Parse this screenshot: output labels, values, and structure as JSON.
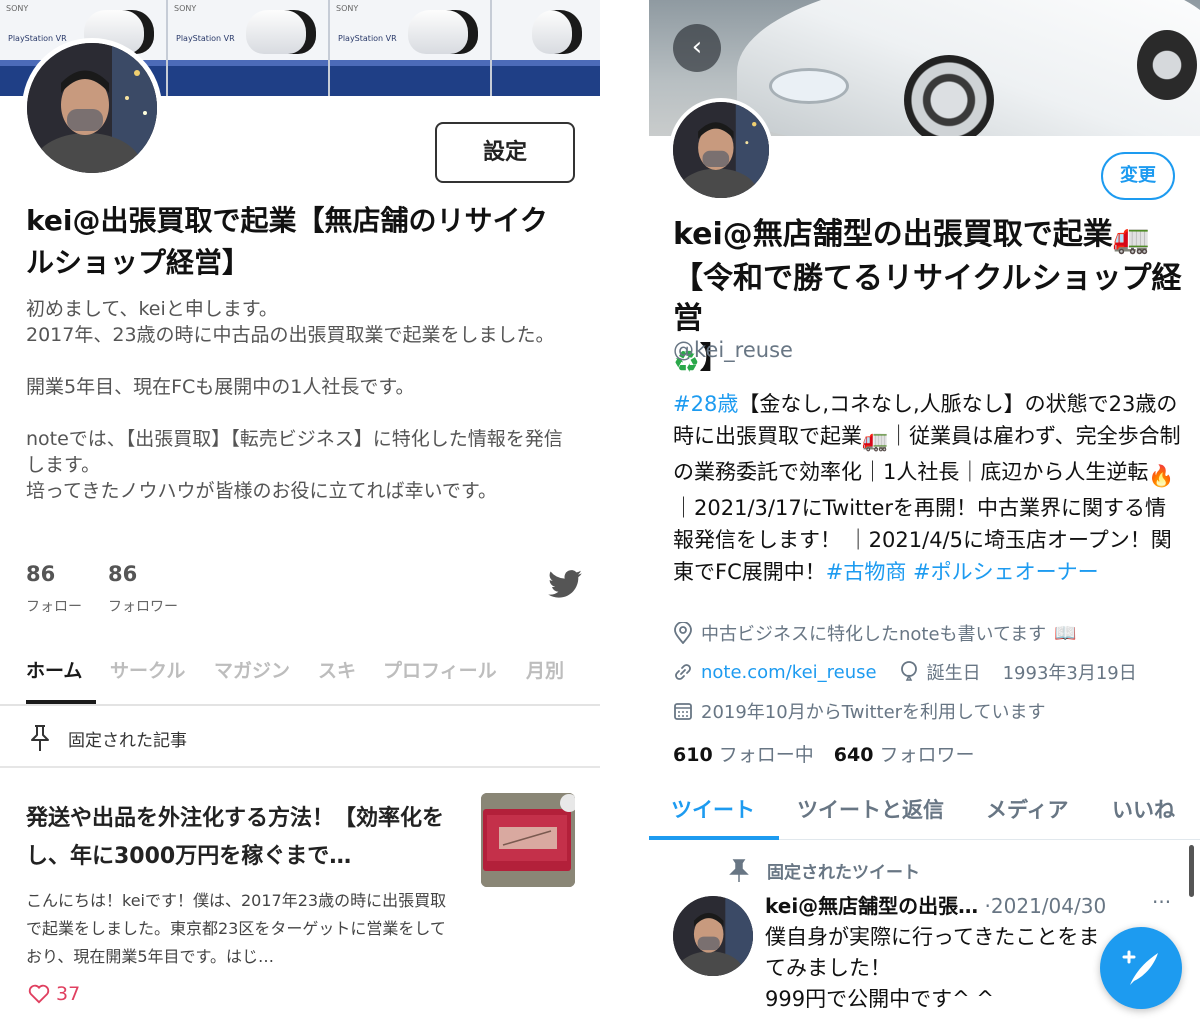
{
  "note_profile": {
    "settings_label": "設定",
    "name": "kei@出張買取で起業【無店舗のリサイクルショップ経営】",
    "bio": [
      "初めまして、keiと申します。\n2017年、23歳の時に中古品の出張買取業で起業をしました。",
      "開業5年目、現在FCも展開中の1人社長です。",
      "noteでは、【出張買取】【転売ビジネス】に特化した情報を発信します。\n培ってきたノウハウが皆様のお役に立てれば幸いです。"
    ],
    "banner": {
      "brand": "SONY",
      "product": "PlayStation VR"
    },
    "stats": [
      {
        "count": "86",
        "label": "フォロー"
      },
      {
        "count": "86",
        "label": "フォロワー"
      }
    ],
    "tabs": [
      "ホーム",
      "サークル",
      "マガジン",
      "スキ",
      "プロフィール",
      "月別"
    ],
    "active_tab": "ホーム",
    "pinned_label": "固定された記事",
    "article": {
      "title": "発送や出品を外注化する方法！【効率化をし、年に3000万円を稼ぐまで…",
      "excerpt": "こんにちは！keiです！僕は、2017年23歳の時に出張買取で起業をしました。東京都23区をターゲットに営業をしており、現在開業5年目です。はじ…",
      "likes": "37"
    }
  },
  "twitter_profile": {
    "edit_label": "変更",
    "name_line1": "kei@無店舗型の出張買取で起業",
    "name_line2": "【令和で勝てるリサイクルショップ経営",
    "name_line2_end": "】",
    "handle": "@kei_reuse",
    "bio": {
      "tag1": "#28歳",
      "text1": "【金なし,コネなし,人脈なし】の状態で23歳の時に出張買取で起業",
      "text2": "｜従業員は雇わず、完全歩合制の業務委託で効率化｜1人社長｜底辺から人生逆転",
      "text3": "｜2021/3/17にTwitterを再開！中古業界に関する情報発信をします！ ｜2021/4/5に埼玉店オープン！関東でFC展開中！",
      "tag2": "#古物商",
      "tag3": "#ポルシェオーナー"
    },
    "location": "中古ビジネスに特化したnoteも書いてます",
    "link": "note.com/kei_reuse",
    "birthday_label": "誕生日",
    "birthday": "1993年3月19日",
    "joined": "2019年10月からTwitterを利用しています",
    "following_count": "610",
    "following_label": "フォロー中",
    "followers_count": "640",
    "followers_label": "フォロワー",
    "tabs": [
      "ツイート",
      "ツイートと返信",
      "メディア",
      "いいね"
    ],
    "active_tab": "ツイート",
    "pinned_tweet_label": "固定されたツイート",
    "tweet": {
      "author": "kei@無店舗型の出張…",
      "date": "·2021/04/30",
      "more": "···",
      "body_line1": "僕自身が実際に行ってきたことをま",
      "body_line2": "てみました！",
      "body_line3": "999円で公開中です^ ^"
    }
  },
  "colors": {
    "twitter_blue": "#1d9bf0",
    "note_like": "#e04060"
  },
  "icons": [
    "pin-icon",
    "twitter-bird-icon",
    "heart-icon",
    "location-icon",
    "link-icon",
    "balloon-icon",
    "calendar-icon",
    "back-arrow-icon",
    "compose-icon",
    "truck-emoji",
    "recycle-emoji",
    "fire-emoji",
    "book-emoji"
  ]
}
